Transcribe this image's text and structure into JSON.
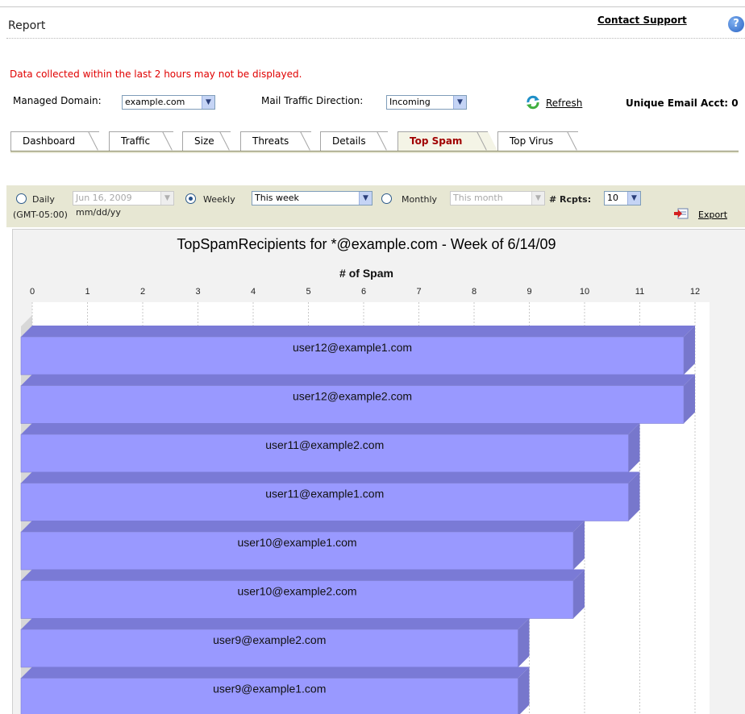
{
  "header": {
    "title": "Report",
    "support_link": "Contact Support",
    "help_icon": "?"
  },
  "notice": "Data collected within the last 2 hours may not be displayed.",
  "filters": {
    "managed_domain_label": "Managed Domain:",
    "managed_domain_value": "example.com",
    "direction_label": "Mail Traffic Direction:",
    "direction_value": "Incoming",
    "refresh_label": "Refresh",
    "unique_label": "Unique Email Acct: 0"
  },
  "tabs": [
    {
      "label": "Dashboard",
      "active": false
    },
    {
      "label": "Traffic",
      "active": false
    },
    {
      "label": "Size",
      "active": false
    },
    {
      "label": "Threats",
      "active": false
    },
    {
      "label": "Details",
      "active": false
    },
    {
      "label": "Top Spam",
      "active": true
    },
    {
      "label": "Top Virus",
      "active": false
    }
  ],
  "period": {
    "daily_label": "Daily",
    "daily_value": "Jun 16, 2009",
    "date_format": "mm/dd/yy",
    "weekly_label": "Weekly",
    "weekly_value": "This week",
    "monthly_label": "Monthly",
    "monthly_value": "This month",
    "selected": "Weekly",
    "rcpts_label": "# Rcpts:",
    "rcpts_value": "10",
    "timezone": "(GMT-05:00)",
    "export_label": "Export"
  },
  "colors": {
    "bar": "#9999ff",
    "bar_side": "#7777cc",
    "bar_top": "#7a7ad6",
    "notice": "#e00000",
    "active_tab": "#a00000"
  },
  "chart_data": {
    "type": "bar",
    "orientation": "horizontal",
    "title": "TopSpamRecipients for *@example.com - Week of 6/14/09",
    "xlabel": "# of Spam",
    "xlim": [
      0,
      12
    ],
    "xticks": [
      "0",
      "1",
      "2",
      "3",
      "4",
      "5",
      "6",
      "7",
      "8",
      "9",
      "10",
      "11",
      "12"
    ],
    "categories": [
      "user12@example1.com",
      "user12@example2.com",
      "user11@example2.com",
      "user11@example1.com",
      "user10@example1.com",
      "user10@example2.com",
      "user9@example2.com",
      "user9@example1.com"
    ],
    "values": [
      12,
      12,
      11,
      11,
      10,
      10,
      9,
      9
    ],
    "grid": true
  }
}
